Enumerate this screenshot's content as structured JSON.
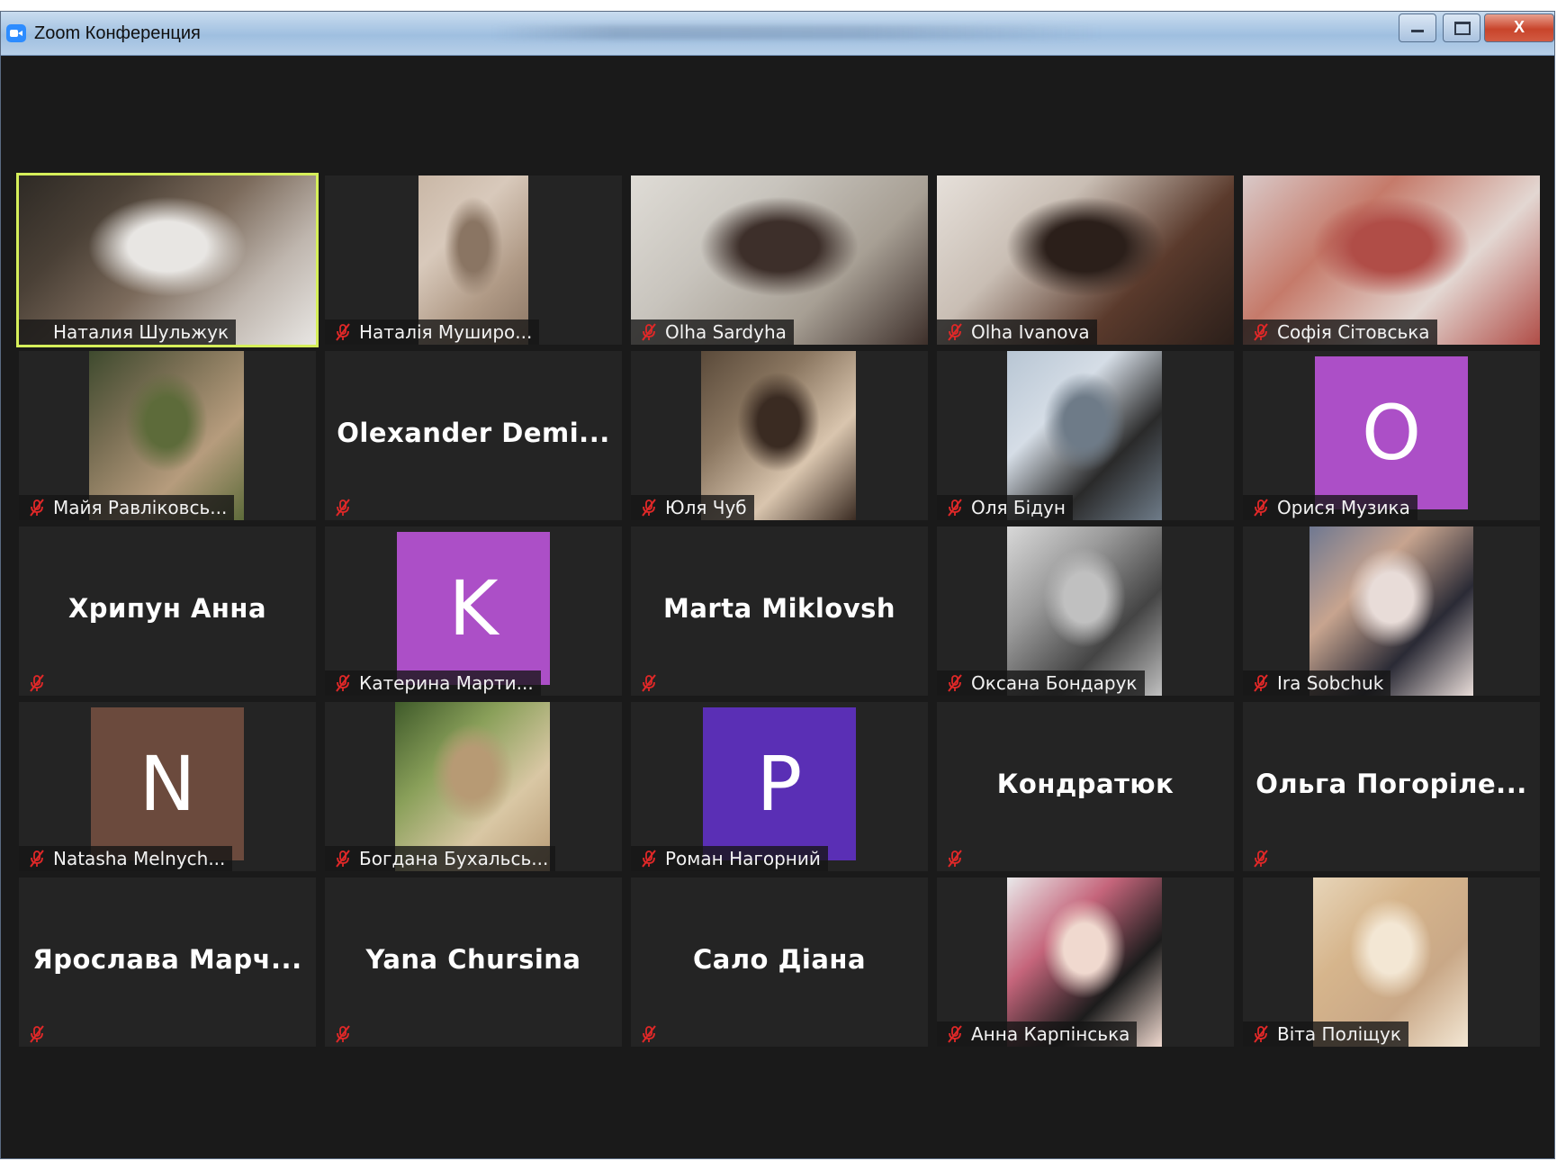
{
  "window": {
    "title": "Zoom Конференция",
    "min_glyph": "",
    "max_glyph": "",
    "close_glyph": "X"
  },
  "participants": [
    {
      "id": "p1",
      "name": "Наталия Шульжук",
      "display": "video",
      "active": true,
      "mic": false,
      "tones": [
        "#2e2a25",
        "#4a4036",
        "#7b6a5b",
        "#bfb6ae",
        "#e8e6e3"
      ]
    },
    {
      "id": "p2",
      "name": "Наталія Муширо...",
      "display": "video",
      "mic": true,
      "tones": [
        "#c9b7a6",
        "#d8c9bb",
        "#b09a86",
        "#8a7563"
      ]
    },
    {
      "id": "p3",
      "name": "Olha Sardyha",
      "display": "video",
      "mic": true,
      "tones": [
        "#dfdcd6",
        "#c8c4bd",
        "#a79f94",
        "#3d2f2a"
      ]
    },
    {
      "id": "p4",
      "name": "Olha Ivanova",
      "display": "video",
      "mic": true,
      "tones": [
        "#e6e0da",
        "#c9beb4",
        "#5a3a2c",
        "#2b1f1a"
      ]
    },
    {
      "id": "p5",
      "name": "Софія Сітовська",
      "display": "video",
      "mic": true,
      "tones": [
        "#d9c9c8",
        "#c57a6a",
        "#e3d7d2",
        "#b04d47"
      ]
    },
    {
      "id": "p6",
      "name": "Майя Равліковсь...",
      "display": "video",
      "mic": true,
      "tones": [
        "#3e4a2e",
        "#7a6f54",
        "#b69c7d",
        "#5d6b3a"
      ]
    },
    {
      "id": "p7",
      "name": "Olexander  Demi...",
      "display": "name",
      "mic": true
    },
    {
      "id": "p8",
      "name": "Юля Чуб",
      "display": "video",
      "mic": true,
      "tones": [
        "#5a4a3a",
        "#8a7660",
        "#d9c5ae",
        "#3a2b22"
      ]
    },
    {
      "id": "p9",
      "name": "Оля Бідун",
      "display": "video",
      "mic": true,
      "tones": [
        "#b8c6d4",
        "#d5dde6",
        "#2a2a2a",
        "#6e7b88"
      ]
    },
    {
      "id": "p10",
      "name": "Орися Музика",
      "display": "avatar",
      "letter": "O",
      "avatar_color": "#ac4fc7",
      "mic": true
    },
    {
      "id": "p11",
      "name": "Хрипун Анна",
      "display": "name",
      "mic": true
    },
    {
      "id": "p12",
      "name": "Катерина Марти...",
      "display": "avatar",
      "letter": "K",
      "avatar_color": "#ac4fc7",
      "mic": true
    },
    {
      "id": "p13",
      "name": "Marta Miklovsh",
      "display": "name",
      "mic": true
    },
    {
      "id": "p14",
      "name": "Оксана Бондарук",
      "display": "video",
      "mic": true,
      "tones": [
        "#d8d8d8",
        "#9a9a9a",
        "#444444",
        "#c0c0c0"
      ]
    },
    {
      "id": "p15",
      "name": "Ira Sobchuk",
      "display": "video",
      "mic": true,
      "tones": [
        "#6f7891",
        "#c7a48f",
        "#2a2a35",
        "#e8dcd8"
      ]
    },
    {
      "id": "p16",
      "name": "Natasha Melnych...",
      "display": "avatar",
      "letter": "N",
      "avatar_color": "#6b4a3d",
      "mic": true
    },
    {
      "id": "p17",
      "name": "Богдана Бухальсь...",
      "display": "video",
      "mic": true,
      "tones": [
        "#3f5a2a",
        "#8aa05a",
        "#d9c7a4",
        "#b79a74"
      ]
    },
    {
      "id": "p18",
      "name": "Роман Нагорний",
      "display": "avatar",
      "letter": "P",
      "avatar_color": "#5a2fb5",
      "mic": true
    },
    {
      "id": "p19",
      "name": "Кондратюк",
      "display": "name",
      "mic": true
    },
    {
      "id": "p20",
      "name": "Ольга  Погоріле...",
      "display": "name",
      "mic": true
    },
    {
      "id": "p21",
      "name": "Ярослава  Марч...",
      "display": "name",
      "mic": true
    },
    {
      "id": "p22",
      "name": "Yana Chursina",
      "display": "name",
      "mic": true
    },
    {
      "id": "p23",
      "name": "Сало Діана",
      "display": "name",
      "mic": true
    },
    {
      "id": "p24",
      "name": "Анна Карпінська",
      "display": "video",
      "mic": true,
      "tones": [
        "#e9e9ea",
        "#c5657b",
        "#1c1c1c",
        "#f0d9cf"
      ]
    },
    {
      "id": "p25",
      "name": "Віта Поліщук",
      "display": "video",
      "mic": true,
      "tones": [
        "#e7d5b9",
        "#d6b58c",
        "#c9a887",
        "#f3e7d4"
      ]
    }
  ],
  "colors": {
    "background": "#1a1a1a",
    "tile": "#242424",
    "active_border": "#d6ef5a",
    "muted_icon": "#e02828"
  }
}
